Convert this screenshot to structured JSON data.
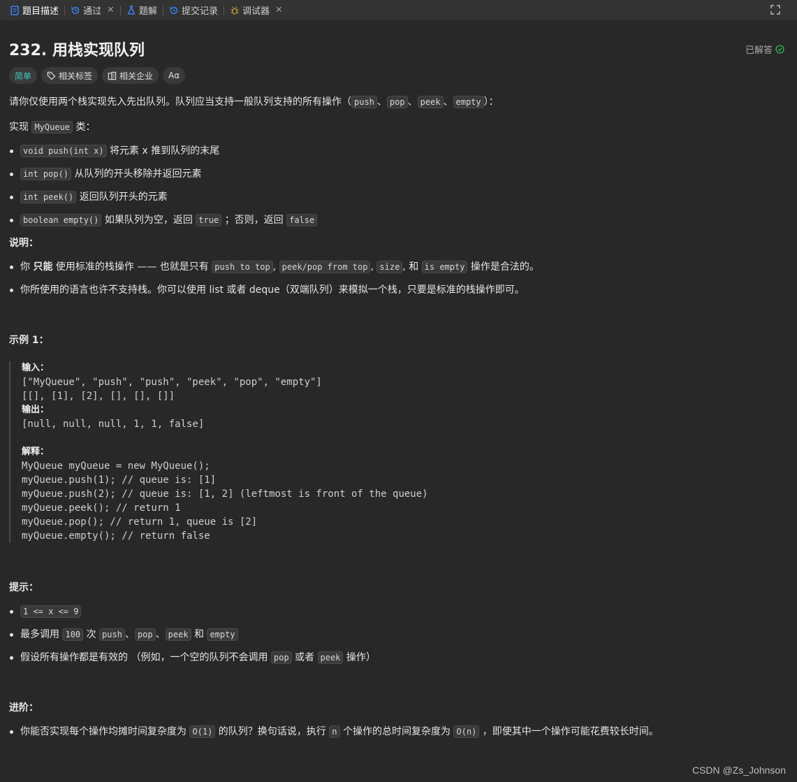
{
  "tabs": [
    {
      "label": "题目描述",
      "icon": "document-icon",
      "closable": false
    },
    {
      "label": "通过",
      "icon": "history-icon",
      "closable": true
    },
    {
      "label": "题解",
      "icon": "flask-icon",
      "closable": false
    },
    {
      "label": "提交记录",
      "icon": "history-icon",
      "closable": false
    },
    {
      "label": "调试器",
      "icon": "bug-icon",
      "closable": true
    }
  ],
  "problem": {
    "title": "232. 用栈实现队列",
    "status": "已解答",
    "difficulty": "简单",
    "tag_label": "相关标签",
    "company_label": "相关企业",
    "font_label": "Aα"
  },
  "intro": {
    "text": "请你仅使用两个栈实现先入先出队列。队列应当支持一般队列支持的所有操作（",
    "ops": [
      "push",
      "pop",
      "peek",
      "empty"
    ],
    "sep": "、",
    "end": "）："
  },
  "impl": {
    "pre": "实现 ",
    "cls": "MyQueue",
    "post": " 类："
  },
  "methods": [
    {
      "code": "void push(int x)",
      "desc": " 将元素 x 推到队列的末尾"
    },
    {
      "code": "int pop()",
      "desc": " 从队列的开头移除并返回元素"
    },
    {
      "code": "int peek()",
      "desc": " 返回队列开头的元素"
    },
    {
      "code": "boolean empty()",
      "desc": " 如果队列为空，返回 ",
      "code2": "true",
      "desc2": " ；否则，返回 ",
      "code3": "false"
    }
  ],
  "notes_heading": "说明：",
  "notes": {
    "n1_pre": "你 ",
    "n1_bold": "只能",
    "n1_mid": " 使用标准的栈操作 —— 也就是只有 ",
    "n1_codes": [
      "push to top",
      "peek/pop from top",
      "size"
    ],
    "n1_and": ", 和 ",
    "n1_code4": "is empty",
    "n1_end": " 操作是合法的。",
    "n2": "你所使用的语言也许不支持栈。你可以使用 list 或者 deque（双端队列）来模拟一个栈，只要是标准的栈操作即可。"
  },
  "example": {
    "heading": "示例 1：",
    "input_label": "输入：",
    "input_lines": [
      "[\"MyQueue\", \"push\", \"push\", \"peek\", \"pop\", \"empty\"]",
      "[[], [1], [2], [], [], []]"
    ],
    "output_label": "输出：",
    "output_line": "[null, null, null, 1, 1, false]",
    "explain_label": "解释：",
    "explain_lines": [
      "MyQueue myQueue = new MyQueue();",
      "myQueue.push(1); // queue is: [1]",
      "myQueue.push(2); // queue is: [1, 2] (leftmost is front of the queue)",
      "myQueue.peek(); // return 1",
      "myQueue.pop(); // return 1, queue is [2]",
      "myQueue.empty(); // return false"
    ]
  },
  "hints": {
    "heading": "提示：",
    "h1": "1 <= x <= 9",
    "h2_pre": "最多调用 ",
    "h2_num": "100",
    "h2_mid": " 次 ",
    "h2_codes": [
      "push",
      "pop",
      "peek"
    ],
    "h2_and": " 和 ",
    "h2_last": "empty",
    "h3_pre": "假设所有操作都是有效的 （例如，一个空的队列不会调用 ",
    "h3_c1": "pop",
    "h3_mid": " 或者 ",
    "h3_c2": "peek",
    "h3_end": " 操作）"
  },
  "advanced": {
    "heading": "进阶：",
    "pre": "你能否实现每个操作均摊时间复杂度为 ",
    "c1": "O(1)",
    "mid": " 的队列？换句话说，执行 ",
    "c2": "n",
    "mid2": " 个操作的总时间复杂度为 ",
    "c3": "O(n)",
    "end": " ，即使其中一个操作可能花费较长时间。"
  },
  "watermark": "CSDN @Zs_Johnson",
  "colors": {
    "accent_easy": "#46c6c2",
    "solved_green": "#2cbb5d",
    "tab_blue": "#3b82f6"
  }
}
